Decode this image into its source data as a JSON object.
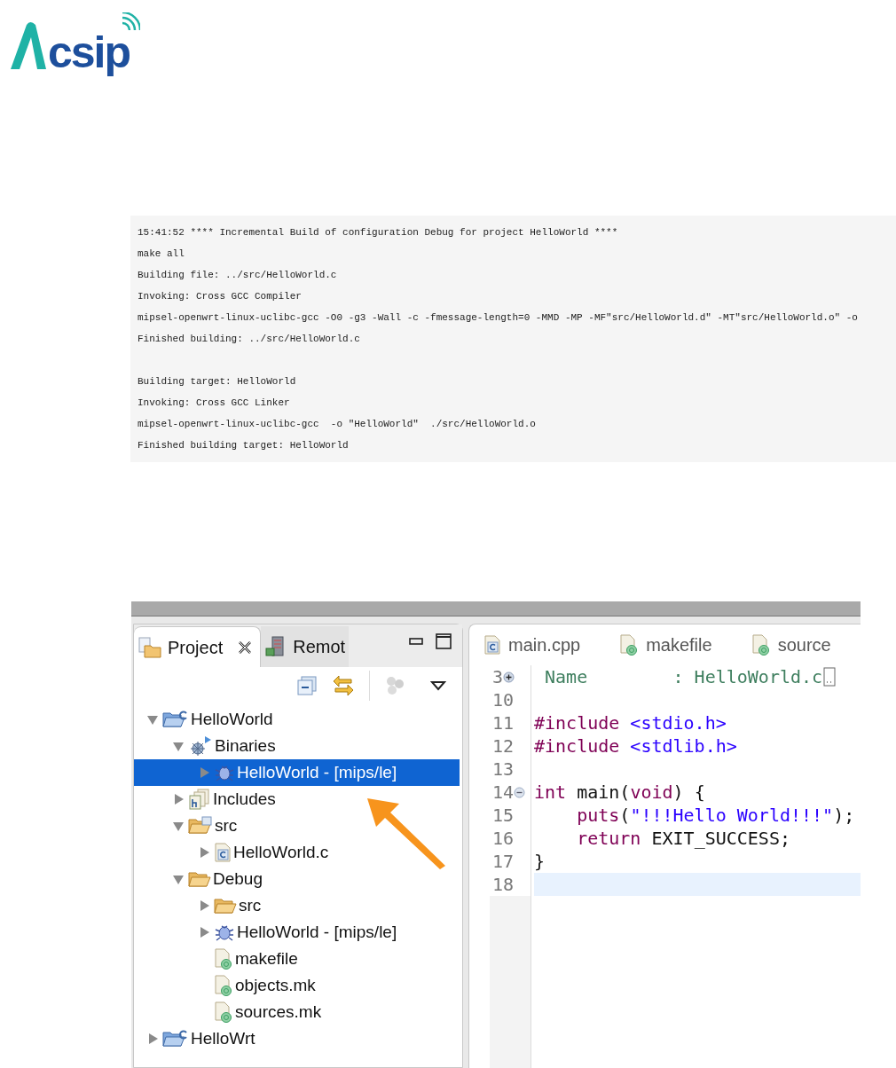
{
  "logo": {
    "text": "csip"
  },
  "console": {
    "blocks": [
      [
        "15:41:52 **** Incremental Build of configuration Debug for project HelloWorld ****",
        "make all",
        "Building file: ../src/HelloWorld.c",
        "Invoking: Cross GCC Compiler",
        "mipsel-openwrt-linux-uclibc-gcc -O0 -g3 -Wall -c -fmessage-length=0 -MMD -MP -MF\"src/HelloWorld.d\" -MT\"src/HelloWorld.o\" -o",
        "Finished building: ../src/HelloWorld.c"
      ],
      [
        "Building target: HelloWorld",
        "Invoking: Cross GCC Linker",
        "mipsel-openwrt-linux-uclibc-gcc  -o \"HelloWorld\"  ./src/HelloWorld.o",
        "Finished building target: HelloWorld"
      ]
    ]
  },
  "ide": {
    "panel_tabs": [
      {
        "label": "Project",
        "kind": "project",
        "selected": true
      },
      {
        "label": "Remot",
        "kind": "server",
        "selected": false
      }
    ],
    "tree": [
      {
        "label": "HelloWorld",
        "kind": "cproject",
        "expanded": true,
        "selected": false,
        "children": [
          {
            "label": "Binaries",
            "kind": "binaries",
            "expanded": true,
            "selected": false,
            "children": [
              {
                "label": "HelloWorld - [mips/le]",
                "kind": "bug",
                "expanded": false,
                "selected": true
              }
            ]
          },
          {
            "label": "Includes",
            "kind": "includes",
            "expanded": false,
            "selected": false
          },
          {
            "label": "src",
            "kind": "srcfolder",
            "expanded": true,
            "selected": false,
            "children": [
              {
                "label": "HelloWorld.c",
                "kind": "cfile",
                "expanded": false,
                "selected": false
              }
            ]
          },
          {
            "label": "Debug",
            "kind": "folder",
            "expanded": true,
            "selected": false,
            "children": [
              {
                "label": "src",
                "kind": "folder",
                "expanded": false,
                "selected": false
              },
              {
                "label": "HelloWorld - [mips/le]",
                "kind": "bug",
                "expanded": false,
                "selected": false
              },
              {
                "label": "makefile",
                "kind": "makefile",
                "selected": false
              },
              {
                "label": "objects.mk",
                "kind": "makefile",
                "selected": false
              },
              {
                "label": "sources.mk",
                "kind": "makefile",
                "selected": false
              }
            ]
          }
        ]
      },
      {
        "label": "HelloWrt",
        "kind": "cproject",
        "expanded": false,
        "selected": false
      }
    ],
    "editor_tabs": [
      {
        "label": "main.cpp",
        "kind": "cfile"
      },
      {
        "label": "makefile",
        "kind": "makefile"
      },
      {
        "label": "source",
        "kind": "makefile"
      }
    ],
    "code": [
      {
        "number": "3",
        "kind": "folded",
        "tokens": [
          {
            "text": " Name        : HelloWorld.c",
            "kind": "comment"
          }
        ]
      },
      {
        "number": "10",
        "kind": "plain"
      },
      {
        "number": "11",
        "kind": "plain",
        "tokens": [
          {
            "text": "#include",
            "kind": "keyword"
          },
          {
            "text": " <stdio.h>",
            "kind": "string"
          }
        ]
      },
      {
        "number": "12",
        "kind": "plain",
        "tokens": [
          {
            "text": "#include",
            "kind": "keyword"
          },
          {
            "text": " <stdlib.h>",
            "kind": "string"
          }
        ]
      },
      {
        "number": "13",
        "kind": "plain"
      },
      {
        "number": "14",
        "kind": "fold_start",
        "tokens": [
          {
            "text": "int",
            "kind": "keyword"
          },
          {
            "text": " main(",
            "kind": "plain"
          },
          {
            "text": "void",
            "kind": "keyword"
          },
          {
            "text": ") {",
            "kind": "plain"
          }
        ]
      },
      {
        "number": "15",
        "kind": "plain",
        "tokens": [
          {
            "text": "    puts",
            "kind": "keyword"
          },
          {
            "text": "(",
            "kind": "plain"
          },
          {
            "text": "\"!!!Hello World!!!\"",
            "kind": "string"
          },
          {
            "text": ");",
            "kind": "plain"
          }
        ]
      },
      {
        "number": "16",
        "kind": "plain",
        "tokens": [
          {
            "text": "    return",
            "kind": "keyword"
          },
          {
            "text": " EXIT_SUCCESS;",
            "kind": "plain"
          }
        ]
      },
      {
        "number": "17",
        "kind": "plain",
        "tokens": [
          {
            "text": "}",
            "kind": "plain"
          }
        ]
      },
      {
        "number": "18",
        "kind": "plain",
        "current": true
      }
    ]
  }
}
